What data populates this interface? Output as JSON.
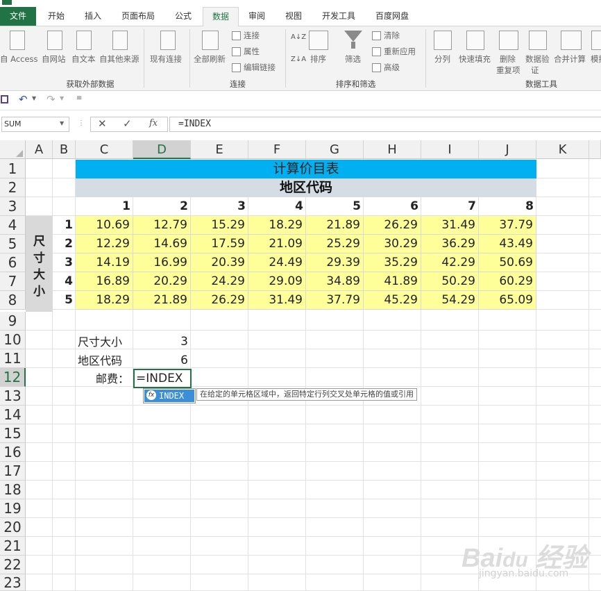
{
  "ribbon_tabs": [
    "文件",
    "开始",
    "插入",
    "页面布局",
    "公式",
    "数据",
    "审阅",
    "视图",
    "开发工具",
    "百度网盘"
  ],
  "ribbon": {
    "get_external": {
      "access": "自 Access",
      "web": "自网站",
      "text": "自文本",
      "other": "自其他来源",
      "existing": "现有连接",
      "group": "获取外部数据"
    },
    "connections": {
      "refresh_all": "全部刷新",
      "connections": "连接",
      "properties": "属性",
      "edit_links": "编辑链接",
      "group": "连接"
    },
    "sort_filter": {
      "sort": "排序",
      "filter": "筛选",
      "clear": "清除",
      "reapply": "重新应用",
      "advanced": "高级",
      "group": "排序和筛选"
    },
    "data_tools": {
      "text_to_columns": "分列",
      "flash_fill": "快速填充",
      "remove_dup_1": "删除",
      "remove_dup_2": "重复项",
      "validation_1": "数据验",
      "validation_2": "证",
      "consolidate": "合并计算",
      "model": "模拟",
      "group": "数据工具"
    }
  },
  "formula_bar": {
    "name_box": "SUM",
    "formula": "=INDEX"
  },
  "columns": [
    "A",
    "B",
    "C",
    "D",
    "E",
    "F",
    "G",
    "H",
    "I",
    "J",
    "K"
  ],
  "selected_column": "D",
  "rows": [
    "1",
    "2",
    "3",
    "4",
    "5",
    "6",
    "7",
    "8",
    "9",
    "10",
    "11",
    "12",
    "13",
    "14",
    "15",
    "16",
    "17",
    "18",
    "19",
    "20",
    "21",
    "22",
    "23"
  ],
  "selected_row": "12",
  "sheet": {
    "title": "计算价目表",
    "subtitle": "地区代码",
    "region_codes": [
      "1",
      "2",
      "3",
      "4",
      "5",
      "6",
      "7",
      "8"
    ],
    "size_label_chars": [
      "尺",
      "寸",
      "大",
      "小"
    ],
    "size_codes": [
      "1",
      "2",
      "3",
      "4",
      "5"
    ],
    "prices": [
      [
        "10.69",
        "12.79",
        "15.29",
        "18.29",
        "21.89",
        "26.29",
        "31.49",
        "37.79"
      ],
      [
        "12.29",
        "14.69",
        "17.59",
        "21.09",
        "25.29",
        "30.29",
        "36.29",
        "43.49"
      ],
      [
        "14.19",
        "16.99",
        "20.39",
        "24.49",
        "29.39",
        "35.29",
        "42.29",
        "50.69"
      ],
      [
        "16.89",
        "20.29",
        "24.29",
        "29.09",
        "34.89",
        "41.89",
        "50.29",
        "60.29"
      ],
      [
        "18.29",
        "21.89",
        "26.29",
        "31.49",
        "37.79",
        "45.29",
        "54.29",
        "65.09"
      ]
    ],
    "size_label": "尺寸大小",
    "size_value": "3",
    "region_label": "地区代码",
    "region_value": "6",
    "postage_label": "邮费：",
    "editing_cell_text": "=INDEX",
    "autocomplete_item": "INDEX",
    "autocomplete_tip": "在给定的单元格区域中，返回特定行列交叉处单元格的值或引用"
  },
  "colors": {
    "excel_green": "#217346",
    "title_blue": "#00b0f0",
    "header_gray": "#d6dce4",
    "data_yellow": "#ffff99",
    "label_gray": "#d9d9d9"
  }
}
